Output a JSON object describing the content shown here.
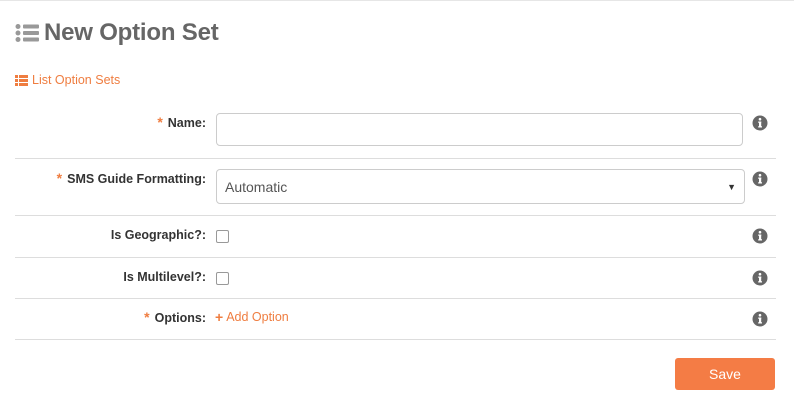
{
  "header": {
    "title": "New Option Set",
    "icon": "list-icon"
  },
  "back_link": {
    "label": "List Option Sets",
    "icon": "list-icon"
  },
  "form": {
    "required_marker": "*",
    "name": {
      "label": "Name:",
      "value": "",
      "required": true
    },
    "sms_guide_formatting": {
      "label": "SMS Guide Formatting:",
      "selected": "Automatic",
      "required": true
    },
    "is_geographic": {
      "label": "Is Geographic?:",
      "checked": false
    },
    "is_multilevel": {
      "label": "Is Multilevel?:",
      "checked": false
    },
    "options": {
      "label": "Options:",
      "required": true,
      "add_label": "Add Option",
      "add_icon": "+"
    }
  },
  "actions": {
    "save_label": "Save"
  },
  "colors": {
    "accent": "#ef7d40",
    "button": "#f47c45",
    "title": "#666666",
    "border": "#dddddd",
    "info_icon": "#666666"
  }
}
